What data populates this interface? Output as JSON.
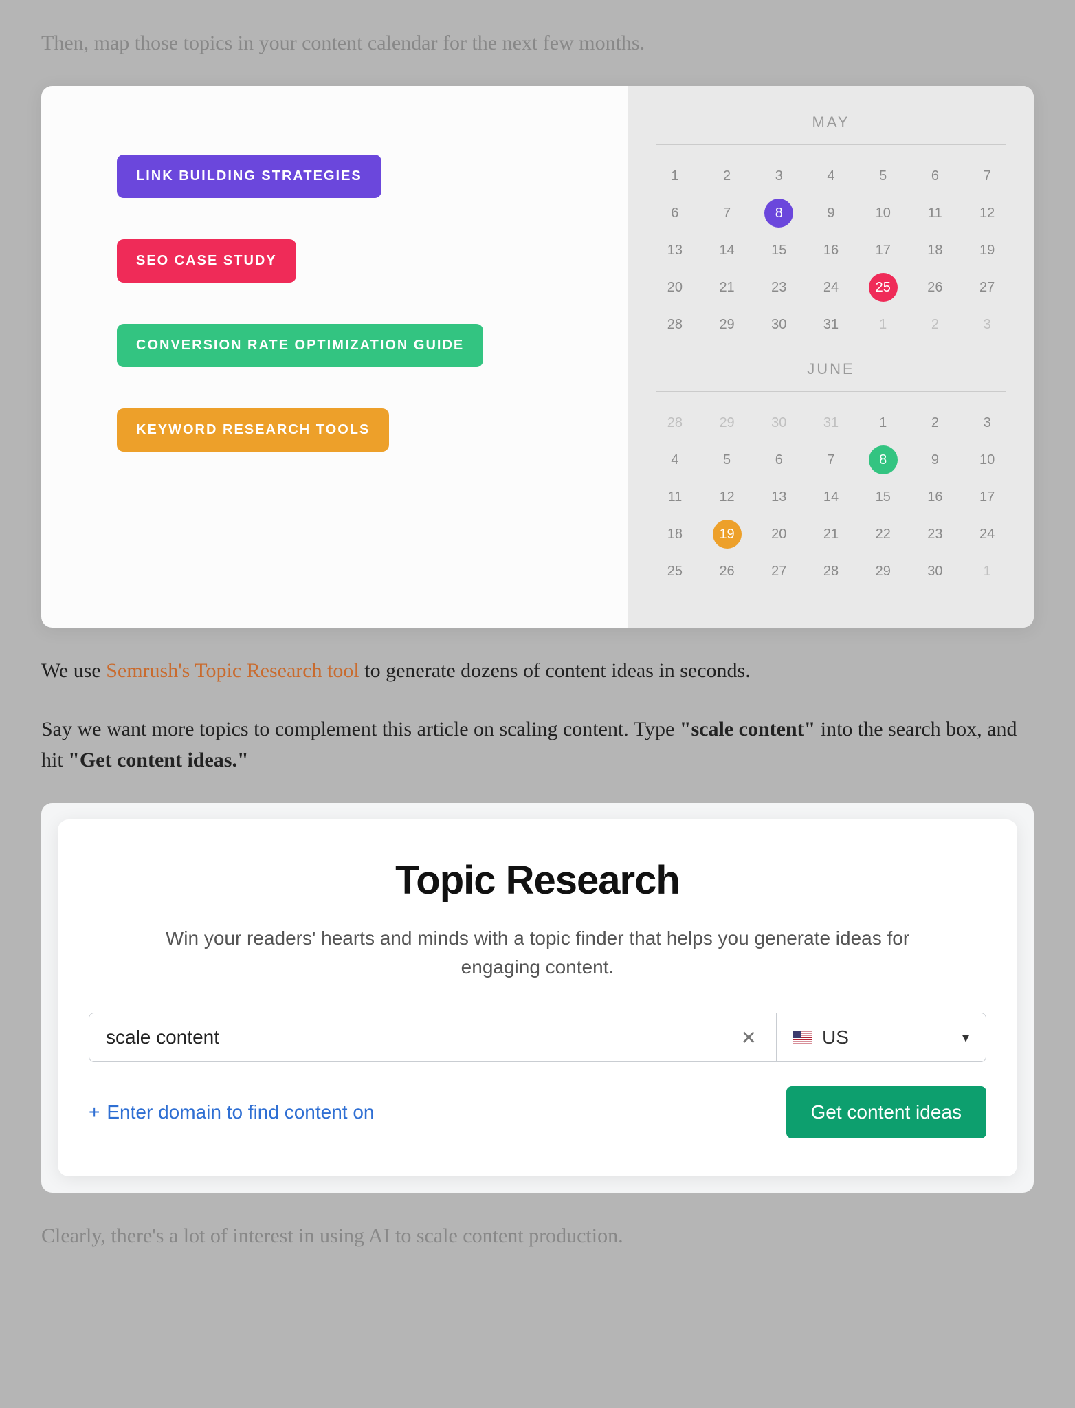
{
  "para1": "Then, map those topics in your content calendar for the next few months.",
  "tags": [
    {
      "label": "LINK BUILDING STRATEGIES",
      "cls": "tag-purple"
    },
    {
      "label": "SEO CASE STUDY",
      "cls": "tag-red"
    },
    {
      "label": "CONVERSION RATE OPTIMIZATION GUIDE",
      "cls": "tag-green"
    },
    {
      "label": "KEYWORD RESEARCH TOOLS",
      "cls": "tag-orange"
    }
  ],
  "calendars": [
    {
      "title": "MAY",
      "cells": [
        {
          "n": "1"
        },
        {
          "n": "2"
        },
        {
          "n": "3"
        },
        {
          "n": "4"
        },
        {
          "n": "5"
        },
        {
          "n": "6"
        },
        {
          "n": "7"
        },
        {
          "n": "6"
        },
        {
          "n": "7"
        },
        {
          "n": "8",
          "dot": "dot-purple"
        },
        {
          "n": "9"
        },
        {
          "n": "10"
        },
        {
          "n": "11"
        },
        {
          "n": "12"
        },
        {
          "n": "13"
        },
        {
          "n": "14"
        },
        {
          "n": "15"
        },
        {
          "n": "16"
        },
        {
          "n": "17"
        },
        {
          "n": "18"
        },
        {
          "n": "19"
        },
        {
          "n": "20"
        },
        {
          "n": "21"
        },
        {
          "n": "23"
        },
        {
          "n": "24"
        },
        {
          "n": "25",
          "dot": "dot-red"
        },
        {
          "n": "26"
        },
        {
          "n": "27"
        },
        {
          "n": "28"
        },
        {
          "n": "29"
        },
        {
          "n": "30"
        },
        {
          "n": "31"
        },
        {
          "n": "1",
          "faded": true
        },
        {
          "n": "2",
          "faded": true
        },
        {
          "n": "3",
          "faded": true
        }
      ]
    },
    {
      "title": "JUNE",
      "cells": [
        {
          "n": "28",
          "faded": true
        },
        {
          "n": "29",
          "faded": true
        },
        {
          "n": "30",
          "faded": true
        },
        {
          "n": "31",
          "faded": true
        },
        {
          "n": "1"
        },
        {
          "n": "2"
        },
        {
          "n": "3"
        },
        {
          "n": "4"
        },
        {
          "n": "5"
        },
        {
          "n": "6"
        },
        {
          "n": "7"
        },
        {
          "n": "8",
          "dot": "dot-green"
        },
        {
          "n": "9"
        },
        {
          "n": "10"
        },
        {
          "n": "11"
        },
        {
          "n": "12"
        },
        {
          "n": "13"
        },
        {
          "n": "14"
        },
        {
          "n": "15"
        },
        {
          "n": "16"
        },
        {
          "n": "17"
        },
        {
          "n": "18"
        },
        {
          "n": "19",
          "dot": "dot-orange"
        },
        {
          "n": "20"
        },
        {
          "n": "21"
        },
        {
          "n": "22"
        },
        {
          "n": "23"
        },
        {
          "n": "24"
        },
        {
          "n": "25"
        },
        {
          "n": "26"
        },
        {
          "n": "27"
        },
        {
          "n": "28"
        },
        {
          "n": "29"
        },
        {
          "n": "30"
        },
        {
          "n": "1",
          "faded": true
        }
      ]
    }
  ],
  "para2_pre": "We use ",
  "para2_link": "Semrush's Topic Research tool",
  "para2_post": " to generate dozens of content ideas in seconds.",
  "para3_a": "Say we want more topics to complement this article on scaling content. Type ",
  "para3_b": "\"scale content\"",
  "para3_c": " into the search box, and hit ",
  "para3_d": "\"Get content ideas.\"",
  "tool": {
    "title": "Topic Research",
    "subtitle": "Win your readers' hearts and minds with a topic finder that helps you generate ideas for engaging content.",
    "input_value": "scale content",
    "country": "US",
    "enter_domain": "Enter domain to find content on",
    "cta": "Get content ideas"
  },
  "para4": "Clearly, there's a lot of interest in using AI to scale content production."
}
